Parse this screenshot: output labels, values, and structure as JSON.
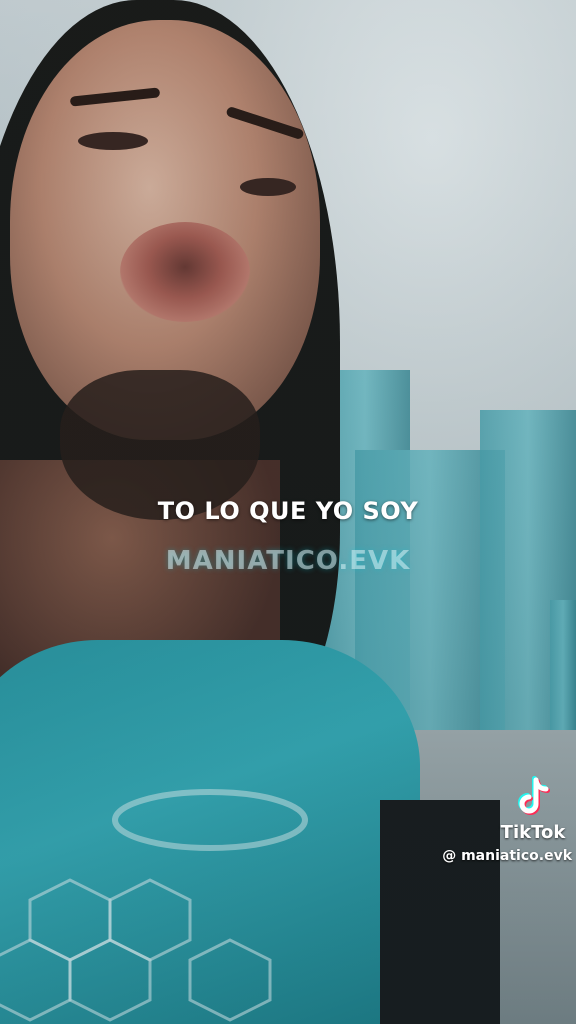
{
  "video": {
    "caption": "TO LO QUE YO SOY",
    "watermark_text": "MANIATICO.EVK"
  },
  "tiktok": {
    "icon": "tiktok-logo-icon",
    "brand": "TikTok",
    "handle": "@ maniatico.evk"
  },
  "colors": {
    "shirt": "#2c9aa6",
    "buildings": "#4fa7b3",
    "tiktok_cyan": "#25f4ee",
    "tiktok_red": "#fe2c55"
  }
}
